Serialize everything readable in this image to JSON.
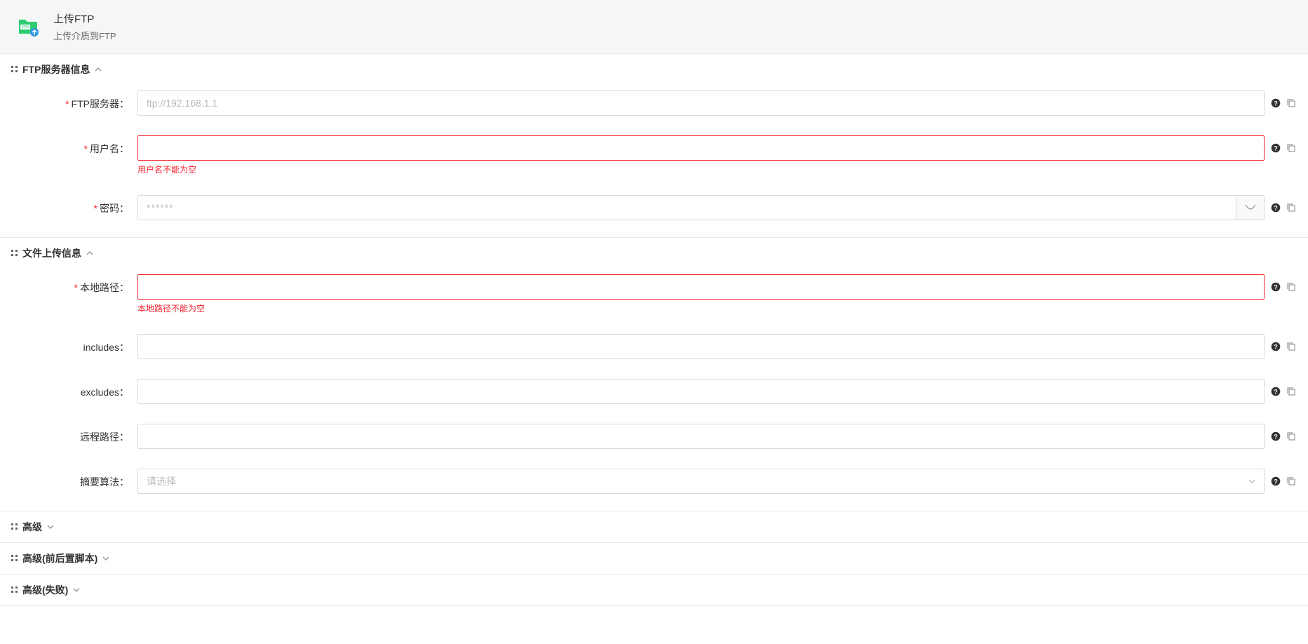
{
  "header": {
    "title": "上传FTP",
    "subtitle": "上传介质到FTP"
  },
  "sections": {
    "server": {
      "title": "FTP服务器信息",
      "fields": {
        "server": {
          "label": "FTP服务器：",
          "placeholder": "ftp://192.168.1.1",
          "value": ""
        },
        "username": {
          "label": "用户名：",
          "value": "",
          "error": "用户名不能为空"
        },
        "password": {
          "label": "密码：",
          "placeholder": "******",
          "value": ""
        }
      }
    },
    "upload": {
      "title": "文件上传信息",
      "fields": {
        "localpath": {
          "label": "本地路径：",
          "value": "",
          "error": "本地路径不能为空"
        },
        "includes": {
          "label": "includes：",
          "value": ""
        },
        "excludes": {
          "label": "excludes：",
          "value": ""
        },
        "remotepath": {
          "label": "远程路径：",
          "value": ""
        },
        "digest": {
          "label": "摘要算法：",
          "placeholder": "请选择"
        }
      }
    },
    "advanced": {
      "title": "高级"
    },
    "advancedScript": {
      "title": "高级(前后置脚本)"
    },
    "advancedFailure": {
      "title": "高级(失败)"
    }
  }
}
